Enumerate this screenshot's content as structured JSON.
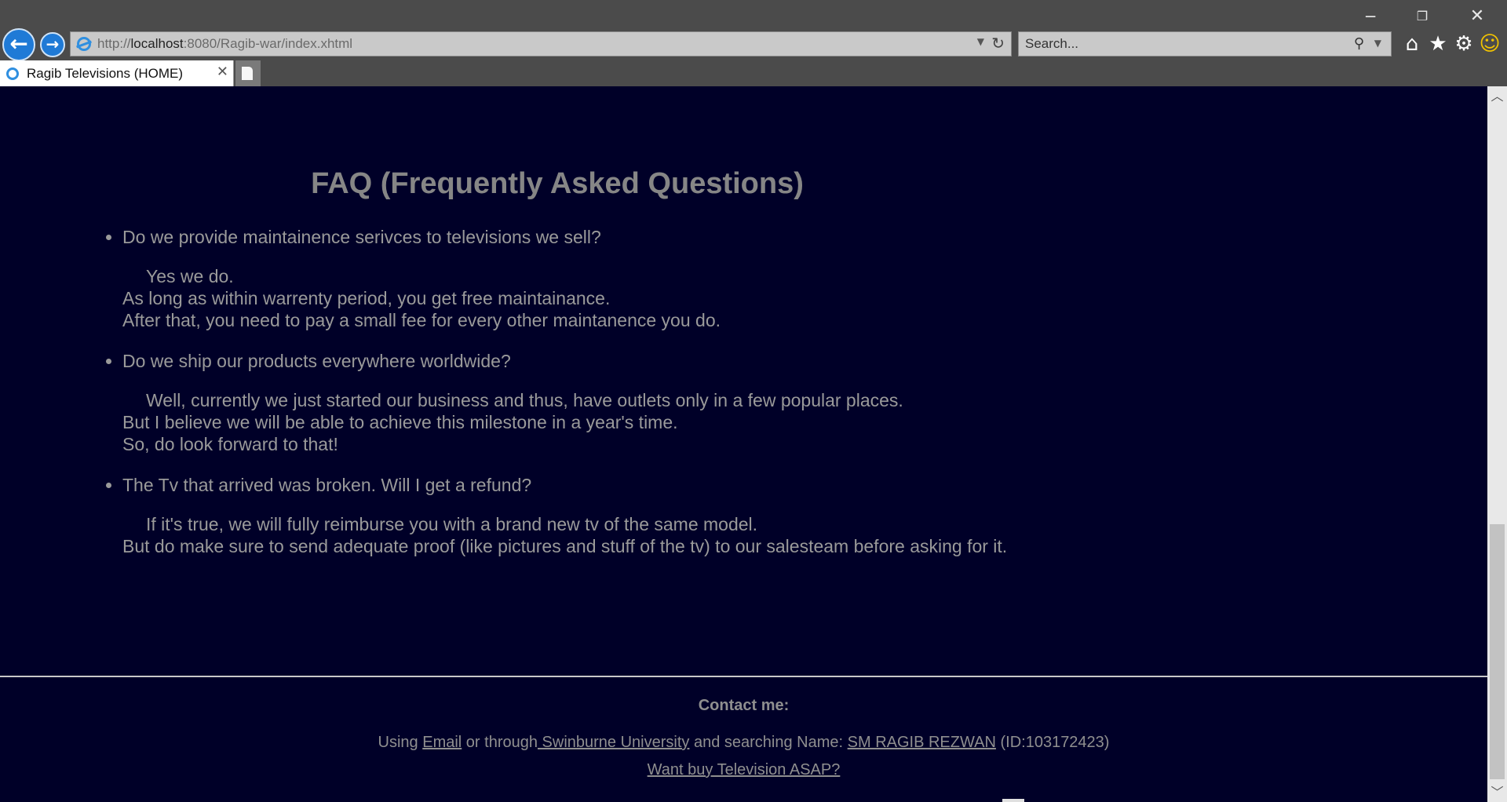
{
  "browser": {
    "url_prefix": "http://",
    "url_host": "localhost",
    "url_rest": ":8080/Ragib-war/index.xhtml",
    "search_placeholder": "Search...",
    "tab_title": "Ragib Televisions (HOME)",
    "icons": {
      "back": "back-arrow-icon",
      "forward": "forward-arrow-icon",
      "refresh": "refresh-icon",
      "search": "search-icon",
      "home": "home-icon",
      "favorites": "star-icon",
      "settings": "gear-icon",
      "feedback": "smiley-icon"
    }
  },
  "page": {
    "faq_title": "FAQ (Frequently Asked Questions)",
    "faqs": [
      {
        "question": "Do we provide maintainence serivces to televisions we sell?",
        "answer_lines": [
          "Yes we do.",
          "As long as within warrenty period, you get free maintainance.",
          "After that, you need to pay a small fee for every other maintanence you do."
        ]
      },
      {
        "question": "Do we ship our products everywhere worldwide?",
        "answer_lines": [
          "Well, currently we just started our business and thus, have outlets only in a few popular places.",
          "But I believe we will be able to achieve this milestone in a year's time.",
          "So, do look forward to that!"
        ]
      },
      {
        "question": "The Tv that arrived was broken. Will I get a refund?",
        "answer_lines": [
          "If it's true, we will fully reimburse you with a brand new tv of the same model.",
          "But do make sure to send adequate proof (like pictures and stuff of the tv) to our salesteam before asking for it."
        ]
      }
    ],
    "footer": {
      "contact_heading": "Contact me:",
      "using": "Using ",
      "email_link": "Email",
      "or_through": " or through",
      "university_link": " Swinburne University",
      "and_searching": " and searching Name: ",
      "name_link": "SM RAGIB REZWAN",
      "id_text": " (ID:103172423)",
      "buy_link": "Want buy Television ASAP?"
    }
  },
  "colors": {
    "page_background": "#000028",
    "text": "#9a9a9a",
    "title": "#868686"
  }
}
